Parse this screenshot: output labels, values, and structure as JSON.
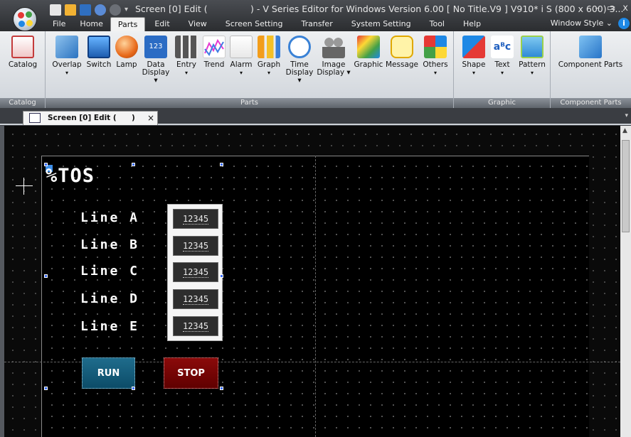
{
  "window": {
    "title_screen": "Screen [0] Edit (",
    "title_app": ") - V Series Editor for Windows Version 6.00 [ No Title.V9 ] V910* i S (800 x 600) 3...",
    "minimize": "–",
    "maximize": "▭",
    "close": "x"
  },
  "menu": {
    "tabs": [
      "File",
      "Home",
      "Parts",
      "Edit",
      "View",
      "Screen Setting",
      "Transfer",
      "System Setting",
      "Tool",
      "Help"
    ],
    "active": "Parts",
    "window_style": "Window Style",
    "window_style_arrow": "⌄",
    "info": "i"
  },
  "ribbon": {
    "catalog_group": {
      "label": "Catalog",
      "buttons": [
        "Catalog"
      ]
    },
    "parts_group": {
      "label": "Parts",
      "buttons": [
        "Overlap",
        "Switch",
        "Lamp",
        "Data Display",
        "Entry",
        "Trend",
        "Alarm",
        "Graph",
        "Time Display",
        "Image Display",
        "Graphic",
        "Message",
        "Others"
      ]
    },
    "graphic_group": {
      "label": "Graphic",
      "buttons": [
        "Shape",
        "Text",
        "Pattern"
      ]
    },
    "component_group": {
      "label": "Component Parts",
      "buttons": [
        "Component Parts"
      ]
    }
  },
  "document_tab": {
    "label": "Screen [0] Edit (",
    "suffix": ")",
    "close": "×"
  },
  "screen": {
    "title": "%TOS",
    "lines": [
      "Line A",
      "Line B",
      "Line C",
      "Line D",
      "Line E"
    ],
    "numeric_values": [
      "12345",
      "12345",
      "12345",
      "12345",
      "12345"
    ],
    "run_label": "RUN",
    "stop_label": "STOP"
  }
}
